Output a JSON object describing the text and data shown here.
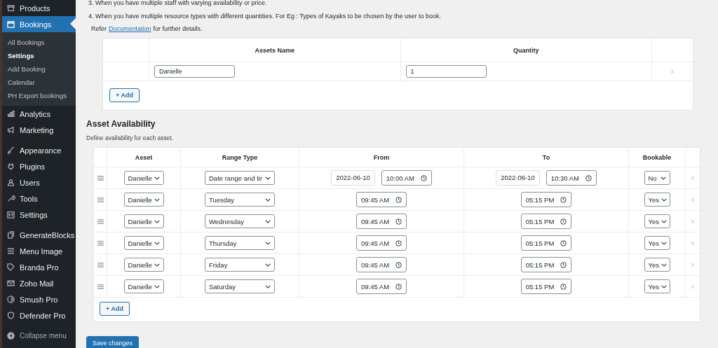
{
  "sidebar": {
    "groups": [
      [
        {
          "label": "Products",
          "selected": false
        },
        {
          "label": "Bookings",
          "selected": true,
          "submenu": [
            {
              "label": "All Bookings",
              "selected": false
            },
            {
              "label": "Settings",
              "selected": true
            },
            {
              "label": "Add Booking",
              "selected": false
            },
            {
              "label": "Calendar",
              "selected": false
            },
            {
              "label": "PH Export bookings",
              "selected": false
            }
          ]
        },
        {
          "label": "Analytics",
          "selected": false
        },
        {
          "label": "Marketing",
          "selected": false
        }
      ],
      [
        {
          "label": "Appearance",
          "selected": false
        },
        {
          "label": "Plugins",
          "selected": false
        },
        {
          "label": "Users",
          "selected": false
        },
        {
          "label": "Tools",
          "selected": false
        },
        {
          "label": "Settings",
          "selected": false
        }
      ],
      [
        {
          "label": "GenerateBlocks",
          "selected": false
        },
        {
          "label": "Menu Image",
          "selected": false
        },
        {
          "label": "Branda Pro",
          "selected": false
        },
        {
          "label": "Zoho Mail",
          "selected": false
        },
        {
          "label": "Smush Pro",
          "selected": false
        },
        {
          "label": "Defender Pro",
          "selected": false
        }
      ]
    ],
    "collapse": "Collapse menu"
  },
  "intro": {
    "list": [
      "3. When you have multiple staff with varying availability or price.",
      "4. When you have multiple resource types with different quantities. For Eg : Types of Kayaks to be chosen by the user to book."
    ],
    "refer_before": "Refer",
    "refer_link": "Documentation",
    "refer_after": "for further details."
  },
  "assets_table": {
    "columns": [
      "Assets Name",
      "Quantity"
    ],
    "rows": [
      {
        "name": "Danielle",
        "quantity": "1",
        "remove": "x"
      }
    ],
    "add_button": "+ Add"
  },
  "availability": {
    "title": "Asset Availability",
    "description": "Define availability for each asset.",
    "columns": [
      "Asset",
      "Range Type",
      "From",
      "To",
      "Bookable"
    ],
    "rows": [
      {
        "kind": "date",
        "asset": "Danielle",
        "range_type": "Date range and tir",
        "from_date": "2022-06-10",
        "from_time": "10:00 AM",
        "to_date": "2022-06-10",
        "to_time": "10:30 AM",
        "bookable": "No",
        "remove": "x"
      },
      {
        "kind": "time",
        "asset": "Danielle",
        "range_type": "Tuesday",
        "from_time": "09:45 AM",
        "to_time": "05:15 PM",
        "bookable": "Yes",
        "remove": "x"
      },
      {
        "kind": "time",
        "asset": "Danielle",
        "range_type": "Wednesday",
        "from_time": "09:45 AM",
        "to_time": "05:15 PM",
        "bookable": "Yes",
        "remove": "x"
      },
      {
        "kind": "time",
        "asset": "Danielle",
        "range_type": "Thursday",
        "from_time": "09:45 AM",
        "to_time": "05:15 PM",
        "bookable": "Yes",
        "remove": "x"
      },
      {
        "kind": "time",
        "asset": "Danielle",
        "range_type": "Friday",
        "from_time": "09:45 AM",
        "to_time": "05:15 PM",
        "bookable": "Yes",
        "remove": "x"
      },
      {
        "kind": "time",
        "asset": "Danielle",
        "range_type": "Saturday",
        "from_time": "09:45 AM",
        "to_time": "05:15 PM",
        "bookable": "Yes",
        "remove": "x"
      }
    ],
    "add_button": "+ Add"
  },
  "save_button": "Save changes"
}
